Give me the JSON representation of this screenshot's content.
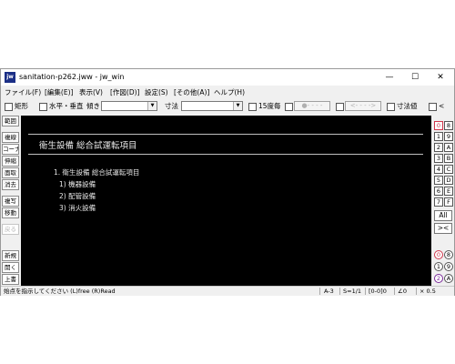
{
  "window": {
    "title": "sanitation-p262.jww - jw_win",
    "icon_label": "jw",
    "minimize": "—",
    "maximize": "☐",
    "close": "✕"
  },
  "menu": [
    "ファイル(F)",
    "[編集(E)]",
    "表示(V)",
    "[作図(D)]",
    "設定(S)",
    "[その他(A)]",
    "ヘルプ(H)"
  ],
  "toolbar": {
    "rect_label": "矩形",
    "hv_label": "水平・垂直",
    "slope_label": "傾き",
    "dim_label": "寸法",
    "deg15_label": "15度毎",
    "btn_a": "●- - - -",
    "btn_b": "<- - - ->",
    "dimval_label": "寸法値",
    "lt_label": "<"
  },
  "left_tools": [
    {
      "label": "範囲",
      "dim": false
    },
    {
      "label": "複線",
      "dim": false
    },
    {
      "label": "コーナー",
      "dim": false
    },
    {
      "label": "伸縮",
      "dim": false
    },
    {
      "label": "面取",
      "dim": false
    },
    {
      "label": "消去",
      "dim": false
    },
    {
      "label": "複写",
      "dim": false
    },
    {
      "label": "移動",
      "dim": false
    },
    {
      "label": "戻る",
      "dim": true
    },
    {
      "label": "新規",
      "dim": false
    },
    {
      "label": "開く",
      "dim": false
    },
    {
      "label": "上書",
      "dim": false
    }
  ],
  "drawing": {
    "heading": "衛生設備 総合試運転項目",
    "item1": "1. 衛生設備 総合試運転項目",
    "sub1": "1) 機器設備",
    "sub2": "2) 配管設備",
    "sub3": "3) 消火設備"
  },
  "layers": {
    "left_col": [
      "0",
      "1",
      "2",
      "3",
      "4",
      "5",
      "6",
      "7"
    ],
    "right_col": [
      "8",
      "9",
      "A",
      "B",
      "C",
      "D",
      "E",
      "F"
    ],
    "all_label": "All",
    "cross_label": "><",
    "group_left": [
      "0",
      "1",
      "2"
    ],
    "group_right": [
      "8",
      "9",
      "A"
    ]
  },
  "status": {
    "message": "始点を指示してください (L)free (R)Read",
    "scale": "A-3",
    "sheet": "S=1/1",
    "layer": "[0-0]0",
    "angle": "∠0",
    "zoom": "× 0.5"
  },
  "colors": {
    "active_layer": "#d1364c",
    "canvas_bg": "#000000"
  }
}
